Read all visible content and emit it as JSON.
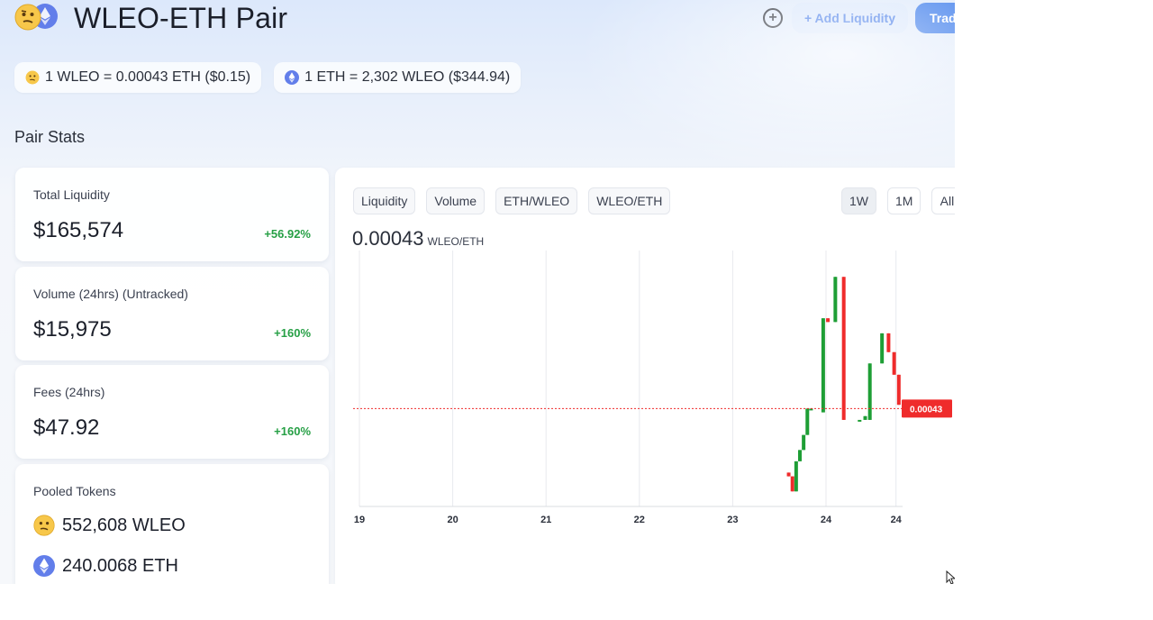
{
  "header": {
    "title": "WLEO-ETH Pair",
    "add_liquidity_label": "+ Add Liquidity",
    "trade_label": "Trade"
  },
  "prices": {
    "wleo_to_eth": "1 WLEO = 0.00043 ETH ($0.15)",
    "eth_to_wleo": "1 ETH = 2,302 WLEO ($344.94)"
  },
  "section_title": "Pair Stats",
  "stats": [
    {
      "label": "Total Liquidity",
      "value": "$165,574",
      "change": "+56.92%"
    },
    {
      "label": "Volume (24hrs) (Untracked)",
      "value": "$15,975",
      "change": "+160%"
    },
    {
      "label": "Fees (24hrs)",
      "value": "$47.92",
      "change": "+160%"
    }
  ],
  "pooled": {
    "label": "Pooled Tokens",
    "wleo": "552,608 WLEO",
    "eth": "240.0068 ETH"
  },
  "chart": {
    "tabs": [
      "Liquidity",
      "Volume",
      "ETH/WLEO",
      "WLEO/ETH"
    ],
    "ranges": [
      "1W",
      "1M",
      "All"
    ],
    "active_range": "1W",
    "price": "0.00043",
    "unit": "WLEO/ETH",
    "current_label": "0.00043"
  },
  "colors": {
    "accent": "#2f73ea",
    "positive": "#27a046",
    "up_candle": "#1e9e35",
    "down_candle": "#ef2b2b"
  },
  "chart_data": {
    "type": "candlestick",
    "x_ticks": [
      "19",
      "20",
      "21",
      "22",
      "23",
      "24",
      "24"
    ],
    "price_line": 0.00043,
    "ylim": [
      0.00017,
      0.00085
    ],
    "candles": [
      {
        "x": 23.6,
        "o": 0.00026,
        "h": 0.00026,
        "c": 0.00025,
        "dir": "down"
      },
      {
        "x": 23.64,
        "o": 0.00025,
        "h": 0.00025,
        "c": 0.00021,
        "dir": "down"
      },
      {
        "x": 23.68,
        "o": 0.00021,
        "h": 0.00029,
        "c": 0.00029,
        "dir": "up"
      },
      {
        "x": 23.72,
        "o": 0.00029,
        "h": 0.00032,
        "c": 0.00032,
        "dir": "up"
      },
      {
        "x": 23.76,
        "o": 0.00032,
        "h": 0.00036,
        "c": 0.00036,
        "dir": "up"
      },
      {
        "x": 23.8,
        "o": 0.00036,
        "h": 0.00043,
        "c": 0.00043,
        "dir": "up"
      },
      {
        "x": 23.84,
        "o": 0.00043,
        "h": 0.00043,
        "c": 0.00043,
        "dir": "up"
      },
      {
        "x": 23.97,
        "o": 0.00042,
        "h": 0.00067,
        "c": 0.00067,
        "dir": "up"
      },
      {
        "x": 24.02,
        "o": 0.00067,
        "h": 0.00067,
        "c": 0.00066,
        "dir": "down"
      },
      {
        "x": 24.1,
        "o": 0.00066,
        "h": 0.00078,
        "c": 0.00078,
        "dir": "up"
      },
      {
        "x": 24.19,
        "o": 0.00078,
        "h": 0.00078,
        "c": 0.0004,
        "dir": "down"
      },
      {
        "x": 24.36,
        "o": 0.0004,
        "h": 0.0004,
        "c": 0.0004,
        "dir": "up"
      },
      {
        "x": 24.42,
        "o": 0.0004,
        "h": 0.00041,
        "c": 0.00041,
        "dir": "up"
      },
      {
        "x": 24.47,
        "o": 0.0004,
        "h": 0.00055,
        "c": 0.00055,
        "dir": "up"
      },
      {
        "x": 24.6,
        "o": 0.00055,
        "h": 0.00063,
        "c": 0.00063,
        "dir": "up"
      },
      {
        "x": 24.67,
        "o": 0.00063,
        "h": 0.00063,
        "c": 0.00058,
        "dir": "down"
      },
      {
        "x": 24.73,
        "o": 0.00058,
        "h": 0.00058,
        "c": 0.00052,
        "dir": "down"
      },
      {
        "x": 24.78,
        "o": 0.00052,
        "h": 0.00052,
        "c": 0.00044,
        "dir": "down"
      }
    ]
  }
}
